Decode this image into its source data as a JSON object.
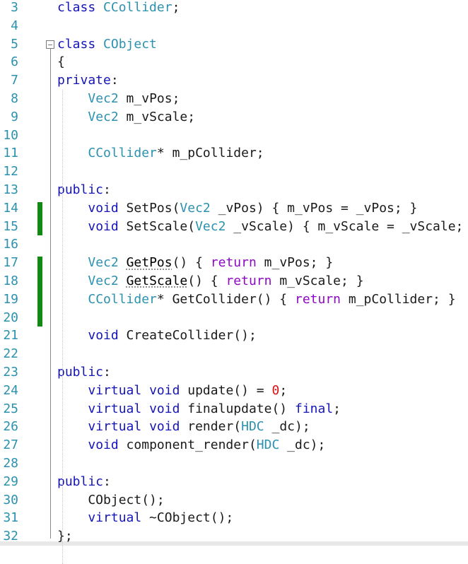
{
  "editor": {
    "lines": [
      {
        "n": "3",
        "tokens": [
          {
            "t": "class",
            "c": "kw"
          },
          {
            "t": " ",
            "c": "pl"
          },
          {
            "t": "CCollider",
            "c": "cls"
          },
          {
            "t": ";",
            "c": "pl"
          }
        ]
      },
      {
        "n": "4",
        "tokens": []
      },
      {
        "n": "5",
        "tokens": [
          {
            "t": "class",
            "c": "kw"
          },
          {
            "t": " ",
            "c": "pl"
          },
          {
            "t": "CObject",
            "c": "cls"
          }
        ]
      },
      {
        "n": "6",
        "tokens": [
          {
            "t": "{",
            "c": "pl"
          }
        ]
      },
      {
        "n": "7",
        "tokens": [
          {
            "t": "private",
            "c": "kw"
          },
          {
            "t": ":",
            "c": "pl"
          }
        ]
      },
      {
        "n": "8",
        "tokens": [
          {
            "t": "    ",
            "c": "pl"
          },
          {
            "t": "Vec2",
            "c": "ty"
          },
          {
            "t": " m_vPos;",
            "c": "pl"
          }
        ]
      },
      {
        "n": "9",
        "tokens": [
          {
            "t": "    ",
            "c": "pl"
          },
          {
            "t": "Vec2",
            "c": "ty"
          },
          {
            "t": " m_vScale;",
            "c": "pl"
          }
        ]
      },
      {
        "n": "10",
        "tokens": []
      },
      {
        "n": "11",
        "tokens": [
          {
            "t": "    ",
            "c": "pl"
          },
          {
            "t": "CCollider",
            "c": "cls"
          },
          {
            "t": "* m_pCollider;",
            "c": "pl"
          }
        ]
      },
      {
        "n": "12",
        "tokens": []
      },
      {
        "n": "13",
        "tokens": [
          {
            "t": "public",
            "c": "kw"
          },
          {
            "t": ":",
            "c": "pl"
          }
        ]
      },
      {
        "n": "14",
        "tokens": [
          {
            "t": "    ",
            "c": "pl"
          },
          {
            "t": "void",
            "c": "kw"
          },
          {
            "t": " SetPos(",
            "c": "pl"
          },
          {
            "t": "Vec2",
            "c": "ty"
          },
          {
            "t": " _vPos) { m_vPos = _vPos; }",
            "c": "pl"
          }
        ]
      },
      {
        "n": "15",
        "tokens": [
          {
            "t": "    ",
            "c": "pl"
          },
          {
            "t": "void",
            "c": "kw"
          },
          {
            "t": " SetScale(",
            "c": "pl"
          },
          {
            "t": "Vec2",
            "c": "ty"
          },
          {
            "t": " _vScale) { m_vScale = _vScale; }",
            "c": "pl"
          }
        ]
      },
      {
        "n": "16",
        "tokens": []
      },
      {
        "n": "17",
        "tokens": [
          {
            "t": "    ",
            "c": "pl"
          },
          {
            "t": "Vec2",
            "c": "ty"
          },
          {
            "t": " ",
            "c": "pl"
          },
          {
            "t": "GetPos",
            "c": "squig"
          },
          {
            "t": "() { ",
            "c": "pl"
          },
          {
            "t": "return",
            "c": "cf"
          },
          {
            "t": " m_vPos; }",
            "c": "pl"
          }
        ]
      },
      {
        "n": "18",
        "tokens": [
          {
            "t": "    ",
            "c": "pl"
          },
          {
            "t": "Vec2",
            "c": "ty"
          },
          {
            "t": " ",
            "c": "pl"
          },
          {
            "t": "GetScale",
            "c": "squig"
          },
          {
            "t": "() { ",
            "c": "pl"
          },
          {
            "t": "return",
            "c": "cf"
          },
          {
            "t": " m_vScale; }",
            "c": "pl"
          }
        ]
      },
      {
        "n": "19",
        "tokens": [
          {
            "t": "    ",
            "c": "pl"
          },
          {
            "t": "CCollider",
            "c": "cls"
          },
          {
            "t": "* GetCollider() { ",
            "c": "pl"
          },
          {
            "t": "return",
            "c": "cf"
          },
          {
            "t": " m_pCollider; }",
            "c": "pl"
          }
        ]
      },
      {
        "n": "20",
        "tokens": []
      },
      {
        "n": "21",
        "tokens": [
          {
            "t": "    ",
            "c": "pl"
          },
          {
            "t": "void",
            "c": "kw"
          },
          {
            "t": " CreateCollider();",
            "c": "pl"
          }
        ]
      },
      {
        "n": "22",
        "tokens": []
      },
      {
        "n": "23",
        "tokens": [
          {
            "t": "public",
            "c": "kw"
          },
          {
            "t": ":",
            "c": "pl"
          }
        ]
      },
      {
        "n": "24",
        "tokens": [
          {
            "t": "    ",
            "c": "pl"
          },
          {
            "t": "virtual",
            "c": "kw"
          },
          {
            "t": " ",
            "c": "pl"
          },
          {
            "t": "void",
            "c": "kw"
          },
          {
            "t": " update() = ",
            "c": "pl"
          },
          {
            "t": "0",
            "c": "num"
          },
          {
            "t": ";",
            "c": "pl"
          }
        ]
      },
      {
        "n": "25",
        "tokens": [
          {
            "t": "    ",
            "c": "pl"
          },
          {
            "t": "virtual",
            "c": "kw"
          },
          {
            "t": " ",
            "c": "pl"
          },
          {
            "t": "void",
            "c": "kw"
          },
          {
            "t": " finalupdate() ",
            "c": "pl"
          },
          {
            "t": "final",
            "c": "kw"
          },
          {
            "t": ";",
            "c": "pl"
          }
        ]
      },
      {
        "n": "26",
        "tokens": [
          {
            "t": "    ",
            "c": "pl"
          },
          {
            "t": "virtual",
            "c": "kw"
          },
          {
            "t": " ",
            "c": "pl"
          },
          {
            "t": "void",
            "c": "kw"
          },
          {
            "t": " render(",
            "c": "pl"
          },
          {
            "t": "HDC",
            "c": "ty"
          },
          {
            "t": " _dc);",
            "c": "pl"
          }
        ]
      },
      {
        "n": "27",
        "tokens": [
          {
            "t": "    ",
            "c": "pl"
          },
          {
            "t": "void",
            "c": "kw"
          },
          {
            "t": " component_render(",
            "c": "pl"
          },
          {
            "t": "HDC",
            "c": "ty"
          },
          {
            "t": " _dc);",
            "c": "pl"
          }
        ]
      },
      {
        "n": "28",
        "tokens": []
      },
      {
        "n": "29",
        "tokens": [
          {
            "t": "public",
            "c": "kw"
          },
          {
            "t": ":",
            "c": "pl"
          }
        ]
      },
      {
        "n": "30",
        "tokens": [
          {
            "t": "    CObject();",
            "c": "pl"
          }
        ]
      },
      {
        "n": "31",
        "tokens": [
          {
            "t": "    ",
            "c": "pl"
          },
          {
            "t": "virtual",
            "c": "kw"
          },
          {
            "t": " ~CObject();",
            "c": "pl"
          }
        ]
      },
      {
        "n": "32",
        "tokens": [
          {
            "t": "};",
            "c": "pl"
          }
        ]
      }
    ],
    "changed_line_groups": [
      [
        "14",
        "15"
      ],
      [
        "17",
        "20"
      ]
    ],
    "colors": {
      "keyword": "#1515b8",
      "type": "#2b91af",
      "control_flow": "#8f08c4",
      "number": "#dd1111",
      "change_marker": "#108a10",
      "line_number": "#2b91af"
    },
    "icons": {
      "fold": "collapse-minus-icon"
    }
  }
}
